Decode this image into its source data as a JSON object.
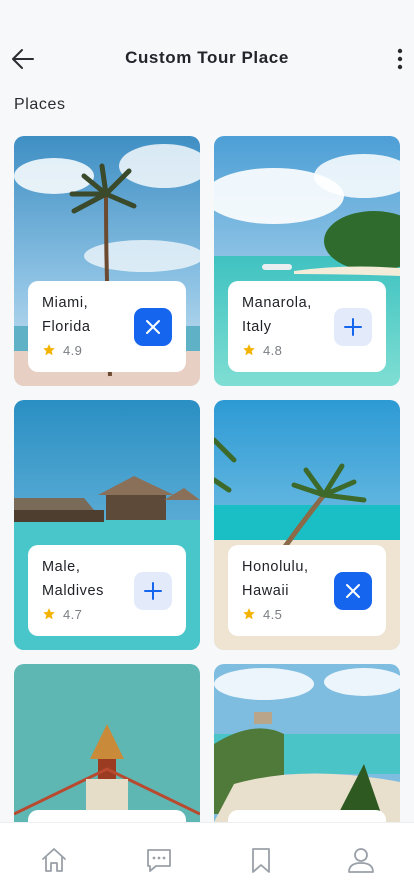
{
  "header": {
    "title": "Custom Tour Place",
    "back_icon": "arrow-left-icon",
    "more_icon": "more-vertical-icon"
  },
  "section": {
    "title": "Places"
  },
  "colors": {
    "accent": "#1565ee",
    "accent_soft": "#e3ebfb",
    "star": "#f5b301",
    "background": "#f7f8fa"
  },
  "places": [
    {
      "name": "Miami, Florida",
      "rating": "4.9",
      "selected": true,
      "action_icon": "close-icon"
    },
    {
      "name": "Manarola, Italy",
      "rating": "4.8",
      "selected": false,
      "action_icon": "plus-icon"
    },
    {
      "name": "Male, Maldives",
      "rating": "4.7",
      "selected": false,
      "action_icon": "plus-icon"
    },
    {
      "name": "Honolulu, Hawaii",
      "rating": "4.5",
      "selected": true,
      "action_icon": "close-icon"
    }
  ],
  "bottom_nav": [
    {
      "icon": "home-icon",
      "active": false
    },
    {
      "icon": "chat-icon",
      "active": false
    },
    {
      "icon": "bookmark-icon",
      "active": false
    },
    {
      "icon": "profile-icon",
      "active": false
    }
  ]
}
